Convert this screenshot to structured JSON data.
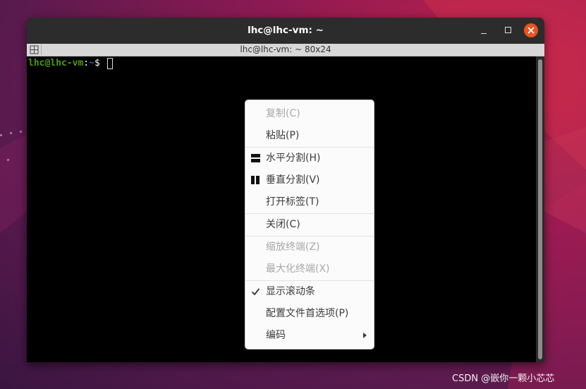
{
  "window": {
    "title": "lhc@lhc-vm: ~",
    "tab_title": "lhc@lhc-vm: ~ 80x24"
  },
  "terminal": {
    "prompt_user": "lhc@lhc-vm",
    "prompt_colon": ":",
    "prompt_path": "~",
    "prompt_dollar": "$ "
  },
  "context_menu": {
    "items": [
      {
        "label": "复制(C)",
        "enabled": false
      },
      {
        "label": "粘贴(P)",
        "enabled": true
      },
      {
        "label": "水平分割(H)",
        "enabled": true,
        "icon": "horizontal-split-icon"
      },
      {
        "label": "垂直分割(V)",
        "enabled": true,
        "icon": "vertical-split-icon"
      },
      {
        "label": "打开标签(T)",
        "enabled": true
      },
      {
        "label": "关闭(C)",
        "enabled": true
      },
      {
        "label": "缩放终端(Z)",
        "enabled": false
      },
      {
        "label": "最大化终端(X)",
        "enabled": false
      },
      {
        "label": "显示滚动条",
        "enabled": true,
        "checked": true
      },
      {
        "label": "配置文件首选项(P)",
        "enabled": true
      },
      {
        "label": "编码",
        "enabled": true,
        "submenu": true
      }
    ]
  },
  "watermark": "CSDN @嵌你一颗小芯芯",
  "colors": {
    "close_button": "#e95420",
    "prompt_user": "#4e9a06",
    "prompt_path": "#3465a4"
  }
}
